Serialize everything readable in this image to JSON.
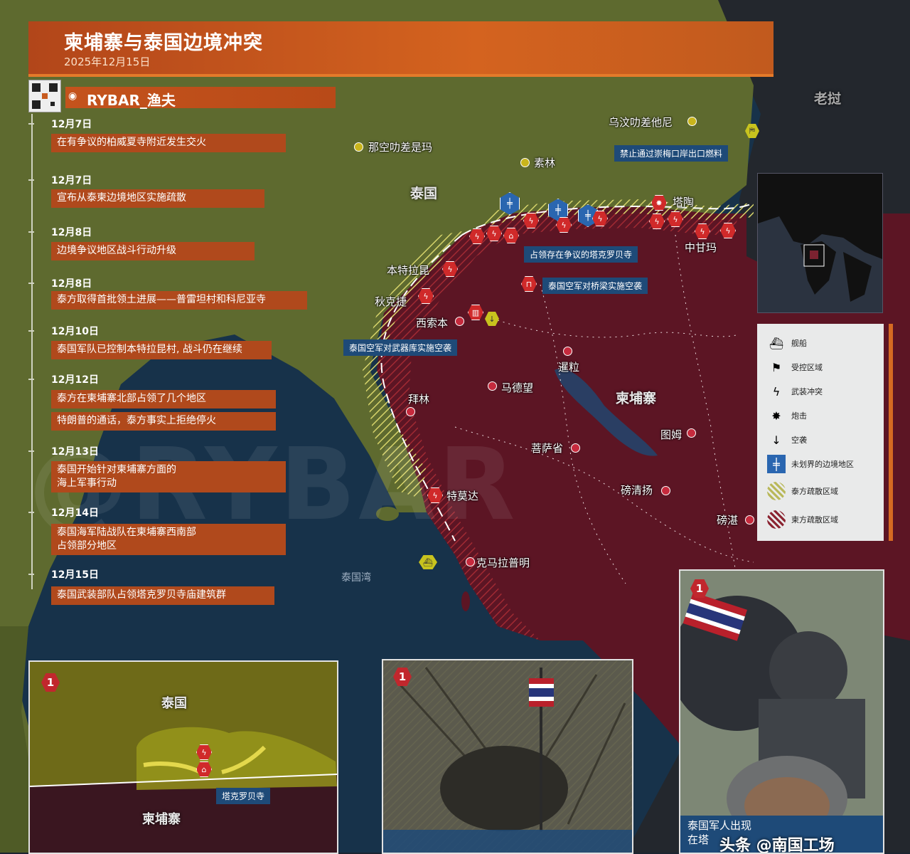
{
  "header": {
    "title": "柬埔寨与泰国边境冲突",
    "date": "2025年12月15日",
    "brand": "RYBAR_渔夫"
  },
  "timeline": [
    {
      "date": "12月7日",
      "lines": [
        "在有争议的柏威夏寺附近发生交火"
      ]
    },
    {
      "date": "12月7日",
      "lines": [
        "宣布从泰柬边境地区实施疏散"
      ]
    },
    {
      "date": "12月8日",
      "lines": [
        "边境争议地区战斗行动升级"
      ]
    },
    {
      "date": "12月8日",
      "lines": [
        "泰方取得首批领土进展——普雷坦村和科尼亚寺"
      ]
    },
    {
      "date": "12月10日",
      "lines": [
        "泰国军队已控制本特拉昆村, 战斗仍在继续"
      ]
    },
    {
      "date": "12月12日",
      "lines": [
        "泰方在柬埔寨北部占领了几个地区",
        "特朗普的通话，泰方事实上拒绝停火"
      ]
    },
    {
      "date": "12月13日",
      "lines": [
        "泰国开始针对柬埔寨方面的",
        "海上军事行动"
      ]
    },
    {
      "date": "12月14日",
      "lines": [
        "泰国海军陆战队在柬埔寨西南部",
        "占领部分地区"
      ]
    },
    {
      "date": "12月15日",
      "lines": [
        "泰国武装部队占领塔克罗贝寺庙建筑群"
      ]
    }
  ],
  "map_labels": {
    "thailand": "泰国",
    "cambodia": "柬埔寨",
    "laos": "老挝",
    "gulf": "泰国湾",
    "ubon": "乌汶叻差他尼",
    "nakhon": "那空叻差是玛",
    "surin": "素林",
    "tapao": "塔陶",
    "oddar": "中甘玛",
    "banteay": "本特拉昆",
    "chikreng": "秋克捷",
    "sisophon": "西索本",
    "siemreap": "暹粒",
    "battambang": "马德望",
    "pailin": "拜林",
    "kampong_thom": "磅清扬",
    "pursat": "菩萨省",
    "tum": "图姆",
    "kampong_cham": "磅湛",
    "thmorda": "特莫达",
    "koh_kong": "克马拉普明"
  },
  "notes": {
    "temple": "占领存在争议的塔克罗贝寺",
    "bridge": "泰国空军对桥梁实施空袭",
    "arsenal": "泰国空军对武器库实施空袭",
    "fuel": "禁止通过崇梅口岸出口燃料"
  },
  "legend": {
    "items": [
      {
        "icon": "ship-icon",
        "label": "舰船"
      },
      {
        "icon": "controlled-area-icon",
        "label": "受控区域"
      },
      {
        "icon": "armed-clash-icon",
        "label": "武装冲突"
      },
      {
        "icon": "shelling-icon",
        "label": "炮击"
      },
      {
        "icon": "airstrike-icon",
        "label": "空袭"
      },
      {
        "icon": "undemarcated-border-icon",
        "label": "未划界的边境地区"
      },
      {
        "icon": "thai-evacuation-icon",
        "label": "泰方疏散区域"
      },
      {
        "icon": "cambodian-evacuation-icon",
        "label": "柬方疏散区域"
      }
    ]
  },
  "inset1": {
    "badge": "1",
    "thailand": "泰国",
    "cambodia": "柬埔寨",
    "temple": "塔克罗贝寺"
  },
  "inset2": {
    "badge": "1"
  },
  "inset3": {
    "badge": "1",
    "caption_line1": "泰国军人出现",
    "caption_line2": "在塔",
    "watermark": "头条 @南国工场"
  },
  "watermark": "@RYBAR",
  "colors": {
    "thai_zone": "#5f6a2c",
    "cambodia_zone": "#6b1a28",
    "accent": "#c9561d",
    "note_blue": "#1e4a78"
  }
}
